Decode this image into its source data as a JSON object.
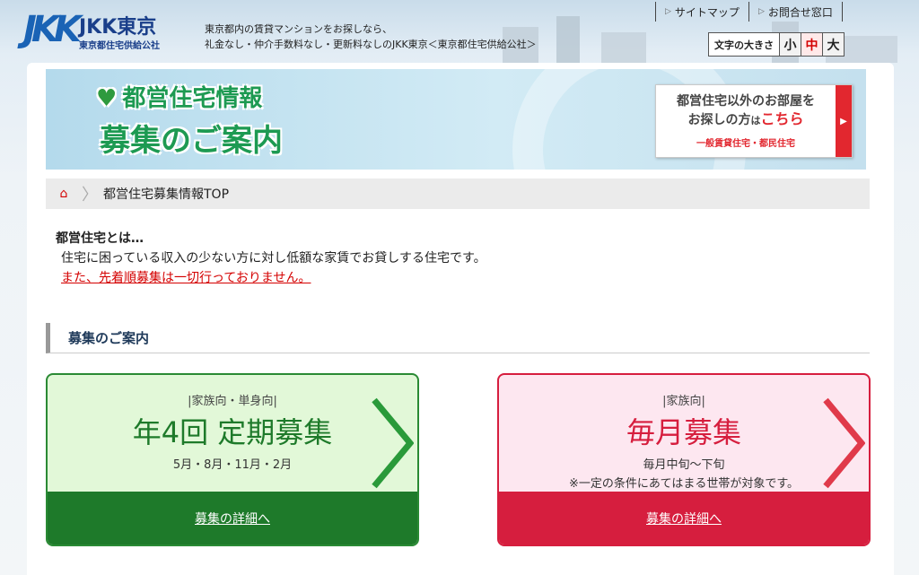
{
  "header": {
    "logo_mark": "JKK",
    "logo_name": "JKK東京",
    "logo_sub": "東京都住宅供給公社",
    "tagline_line1": "東京都内の賃貸マンションをお探しなら、",
    "tagline_line2": "礼金なし・仲介手数料なし・更新料なしのJKK東京＜東京都住宅供給公社＞",
    "links": [
      {
        "label": "サイトマップ"
      },
      {
        "label": "お問合せ窓口"
      }
    ],
    "font_size": {
      "label": "文字の大きさ",
      "options": [
        "小",
        "中",
        "大"
      ],
      "selected": "中"
    }
  },
  "banner": {
    "title_line1": "都営住宅情報",
    "title_line2": "募集のご案内",
    "promo_line1": "都営住宅以外のお部屋を",
    "promo_line2_pre": "お探しの方",
    "promo_line2_small": "は",
    "promo_line2_highlight": "こちら",
    "promo_line3": "一般賃貸住宅・都民住宅"
  },
  "breadcrumb": {
    "current": "都営住宅募集情報TOP"
  },
  "intro": {
    "title": "都営住宅とは…",
    "text": "住宅に困っている収入の少ない方に対し低額な家賃でお貸しする住宅です。",
    "notice": "また、先着順募集は一切行っておりません。"
  },
  "section": {
    "heading": "募集のご案内"
  },
  "cards": [
    {
      "tag": "|家族向・単身向|",
      "title": "年4回 定期募集",
      "sub": "5月・8月・11月・2月",
      "sub2": "",
      "link": "募集の詳細へ",
      "color": "#1e7a2a"
    },
    {
      "tag": "|家族向|",
      "title": "毎月募集",
      "sub": "毎月中旬～下旬",
      "sub2": "※一定の条件にあてはまる世帯が対象です。",
      "link": "募集の詳細へ",
      "color": "#d61e3e"
    }
  ]
}
